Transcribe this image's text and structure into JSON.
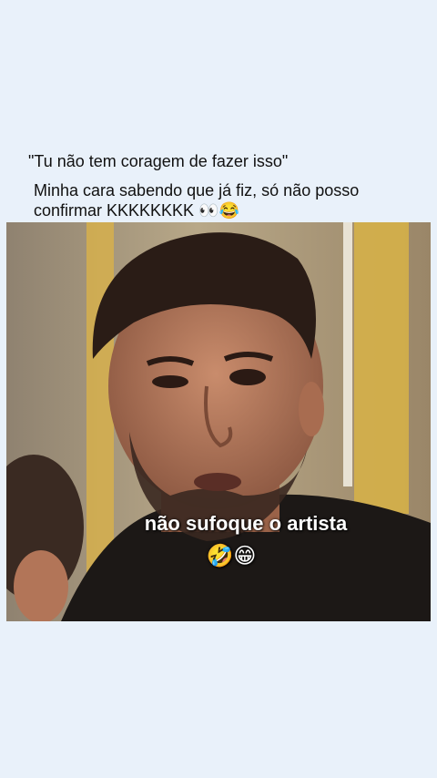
{
  "post": {
    "quote": "\"Tu não tem coragem de fazer isso\"",
    "caption": "Minha cara sabendo que já fiz, só não posso confirmar KKKKKKKK 👀😂"
  },
  "video": {
    "overlay_text": "não sufoque o artista",
    "overlay_emoji": "🤣😁"
  }
}
